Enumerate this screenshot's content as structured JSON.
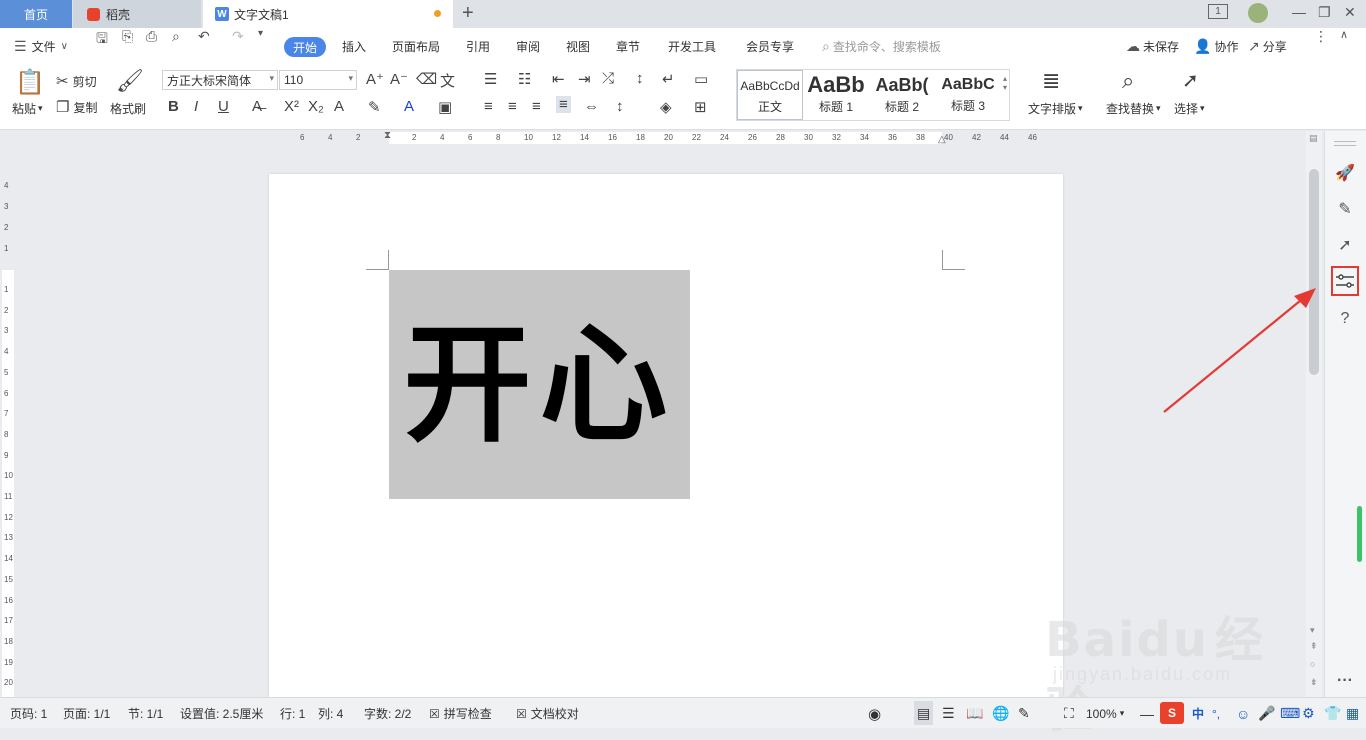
{
  "tabs": {
    "home": "首页",
    "docer": "稻壳",
    "document": "文字文稿1",
    "add": "+"
  },
  "window": {
    "minimize": "—",
    "restore": "❐",
    "close": "✕",
    "layout_badge": "1"
  },
  "menu": {
    "file": "文件",
    "items": [
      "开始",
      "插入",
      "页面布局",
      "引用",
      "审阅",
      "视图",
      "章节",
      "开发工具",
      "会员专享"
    ],
    "search_placeholder": "查找命令、搜索模板",
    "unsaved": "未保存",
    "collaborate": "协作",
    "share": "分享"
  },
  "ribbon": {
    "paste": "粘贴",
    "cut": "剪切",
    "copy": "复制",
    "format_painter": "格式刷",
    "font_name": "方正大标宋简体",
    "font_size": "110",
    "styles": [
      {
        "sample": "AaBbCcDd",
        "name": "正文"
      },
      {
        "sample": "AaBb",
        "name": "标题 1"
      },
      {
        "sample": "AaBb(",
        "name": "标题 2"
      },
      {
        "sample": "AaBbC",
        "name": "标题 3"
      }
    ],
    "text_layout": "文字排版",
    "find_replace": "查找替换",
    "select": "选择"
  },
  "ruler": {
    "h_left": [
      "6",
      "4",
      "2"
    ],
    "h_right": [
      "2",
      "4",
      "6",
      "8",
      "10",
      "12",
      "14",
      "16",
      "18",
      "20",
      "22",
      "24",
      "26",
      "28",
      "30",
      "32",
      "34",
      "36",
      "38",
      "40",
      "42",
      "44",
      "46"
    ],
    "v_top": [
      "4",
      "3",
      "2",
      "1"
    ],
    "v_body": [
      "1",
      "2",
      "3",
      "4",
      "5",
      "6",
      "7",
      "8",
      "9",
      "10",
      "11",
      "12",
      "13",
      "14",
      "15",
      "16",
      "17",
      "18",
      "19",
      "20"
    ]
  },
  "document": {
    "image_text": "开心"
  },
  "status": {
    "page_num": "页码: 1",
    "pages": "页面: 1/1",
    "section": "节: 1/1",
    "setting": "设置值: 2.5厘米",
    "row": "行: 1",
    "col": "列: 4",
    "word_count": "字数: 2/2",
    "spell_check": "拼写检查",
    "doc_proof": "文档校对",
    "zoom": "100%",
    "ime": "中"
  },
  "watermark": {
    "brand": "Baidu",
    "brand_cn": "经验",
    "url": "jingyan.baidu.com"
  },
  "colors": {
    "accent": "#4a86e8",
    "highlight": "#e53935",
    "docer": "#e8412c"
  }
}
